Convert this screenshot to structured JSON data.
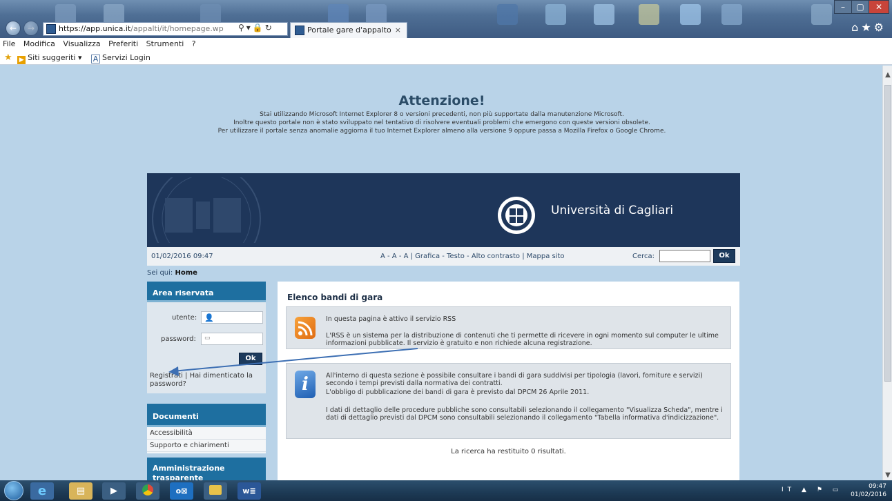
{
  "browser": {
    "url_prefix": "https://",
    "url_domain": "app.unica.it",
    "url_path": "/appalti/it/homepage.wp",
    "tab_title": "Portale gare d'appalto",
    "menu": [
      "File",
      "Modifica",
      "Visualizza",
      "Preferiti",
      "Strumenti",
      "?"
    ],
    "favorites": {
      "suggested": "Siti suggeriti ▾",
      "servizi_login": "Servizi Login"
    }
  },
  "warning": {
    "title": "Attenzione!",
    "line1": "Stai utilizzando Microsoft Internet Explorer 8 o versioni precedenti, non più supportate dalla manutenzione Microsoft.",
    "line2": "Inoltre questo portale non è stato sviluppato nel tentativo di risolvere eventuali problemi che emergono con queste versioni obsolete.",
    "line3": "Per utilizzare il portale senza anomalie aggiorna il tuo Internet Explorer almeno alla versione 9 oppure passa a Mozilla Firefox o Google Chrome."
  },
  "header": {
    "university": "Università di Cagliari",
    "datetime": "01/02/2016 09:47",
    "accessibility_links": "A - A - A | Grafica - Testo - Alto contrasto | Mappa sito",
    "search_label": "Cerca:",
    "search_button": "Ok"
  },
  "breadcrumb": {
    "prefix": "Sei qui:",
    "current": "Home"
  },
  "login": {
    "title": "Area riservata",
    "user_label": "utente:",
    "password_label": "password:",
    "ok": "Ok",
    "register_line1": "Registrati | Hai dimenticato la",
    "register_line2": "password?"
  },
  "documents": {
    "title": "Documenti",
    "links": [
      "Accessibilità",
      "Supporto e chiarimenti"
    ]
  },
  "amministrazione": {
    "title": "Amministrazione trasparente"
  },
  "content": {
    "title": "Elenco bandi di gara",
    "rss_head": "In questa pagina è attivo il servizio RSS",
    "rss_body": "L'RSS è un sistema per la distribuzione di contenuti che ti permette di ricevere in ogni momento sul computer le ultime informazioni pubblicate. Il servizio è gratuito e non richiede alcuna registrazione.",
    "info_p1": "All'interno di questa sezione è possibile consultare i bandi di gara suddivisi per tipologia (lavori, forniture e servizi) secondo i tempi previsti dalla normativa dei contratti.",
    "info_p2": "L'obbligo di pubblicazione dei bandi di gara è previsto dal DPCM 26 Aprile 2011.",
    "info_p3": "I dati di dettaglio delle procedure pubbliche sono consultabili selezionando il collegamento \"Visualizza Scheda\", mentre i dati di dettaglio previsti dal DPCM sono consultabili selezionando il collegamento \"Tabella informativa d'indicizzazione\".",
    "result": "La ricerca ha restituito 0 risultati."
  },
  "taskbar": {
    "lang": "IT",
    "time": "09:47",
    "date": "01/02/2016",
    "app_outlook": "o⊠",
    "app_word": "w≣"
  }
}
